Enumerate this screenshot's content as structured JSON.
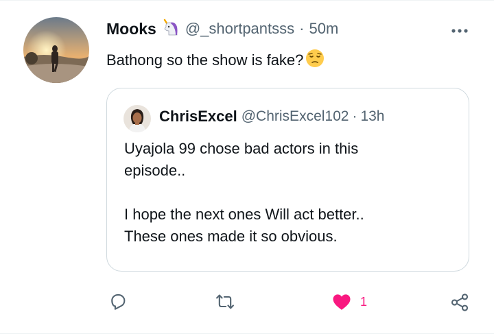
{
  "tweet": {
    "author_name": "Mooks",
    "author_emoji": "unicorn-emoji",
    "handle": "@_shortpantsss",
    "separator": "·",
    "time": "50m",
    "text": "Bathong so the show is fake?",
    "text_emoji": "pensive-face-emoji",
    "more_icon": "more-dots-icon"
  },
  "quote": {
    "author_name": "ChrisExcel",
    "handle": "@ChrisExcel102",
    "separator": "·",
    "time": "13h",
    "lines_1": [
      "Uyajola 99 chose bad actors in this",
      "episode.."
    ],
    "lines_2": [
      "I hope the next ones Will act better..",
      "These ones made it so obvious."
    ]
  },
  "actions": {
    "reply_icon": "reply-icon",
    "retweet_icon": "retweet-icon",
    "like_icon": "heart-icon",
    "like_count": "1",
    "share_icon": "share-icon"
  },
  "colors": {
    "text": "#0f1419",
    "secondary": "#536471",
    "border": "#cfd9de",
    "like": "#f91880"
  }
}
